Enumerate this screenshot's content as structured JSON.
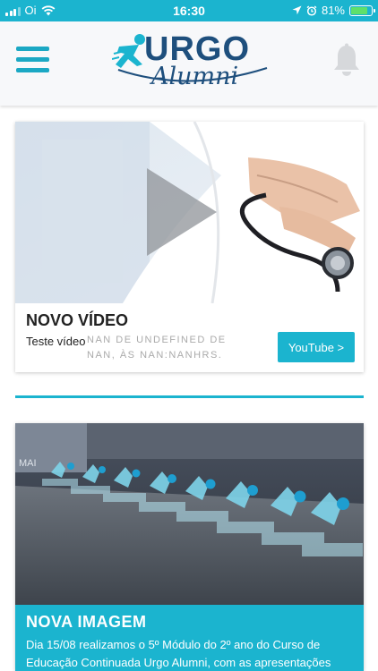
{
  "status_bar": {
    "carrier": "Oi",
    "time": "16:30",
    "battery": "81%",
    "battery_level": 0.81,
    "icons": [
      "signal-bars-icon",
      "wifi-icon",
      "location-arrow-icon",
      "alarm-icon",
      "battery-icon"
    ]
  },
  "header": {
    "logo_main": "URGO",
    "logo_sub": "Alumni",
    "menu_icon": "hamburger-menu-icon",
    "notification_icon": "bell-icon"
  },
  "feed": {
    "video_card": {
      "title": "NOVO VÍDEO",
      "description": "Teste vídeo",
      "date_line1": "NAN DE UNDEFINED DE",
      "date_line2": "NAN, ÀS NAN:NANHRS.",
      "button_label": "YouTube >",
      "thumbnail_icon": "play-icon"
    },
    "image_card": {
      "title": "NOVA IMAGEM",
      "description": "Dia 15/08 realizamos o 5º Módulo do 2º ano do Curso de Educação Continuada Urgo Alumni, com as apresentações",
      "photo_text": "MAI"
    }
  },
  "colors": {
    "accent": "#1bb4cf",
    "brand_dark": "#1e4f7d",
    "battery_green": "#5ee06a"
  }
}
